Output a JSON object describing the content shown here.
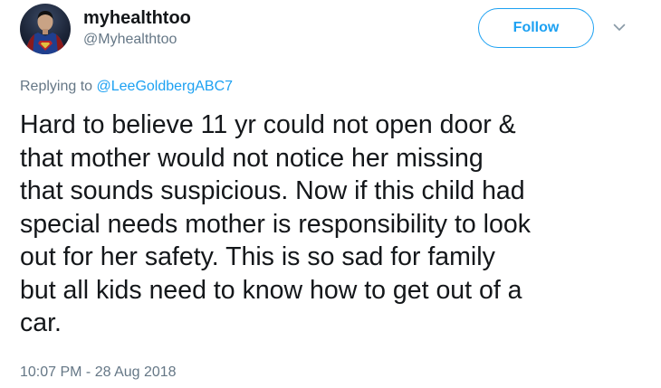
{
  "user": {
    "display_name": "myhealthtoo",
    "handle": "@Myhealthtoo",
    "avatar_icon": "superman-avatar"
  },
  "actions": {
    "follow_label": "Follow",
    "more_icon": "chevron-down-icon"
  },
  "reply": {
    "prefix": "Replying to ",
    "mention": "@LeeGoldbergABC7"
  },
  "tweet": {
    "text": "Hard to believe 11 yr could not open door &\nthat mother would not notice her missing\nthat sounds suspicious. Now if this child had\nspecial needs mother is responsibility to look\nout for her safety. This is so sad for family\nbut all kids need to know how to get out of a\ncar.",
    "timestamp": "10:07 PM - 28 Aug 2018"
  },
  "colors": {
    "accent": "#1da1f2",
    "secondary_text": "#657786",
    "primary_text": "#14171a"
  }
}
